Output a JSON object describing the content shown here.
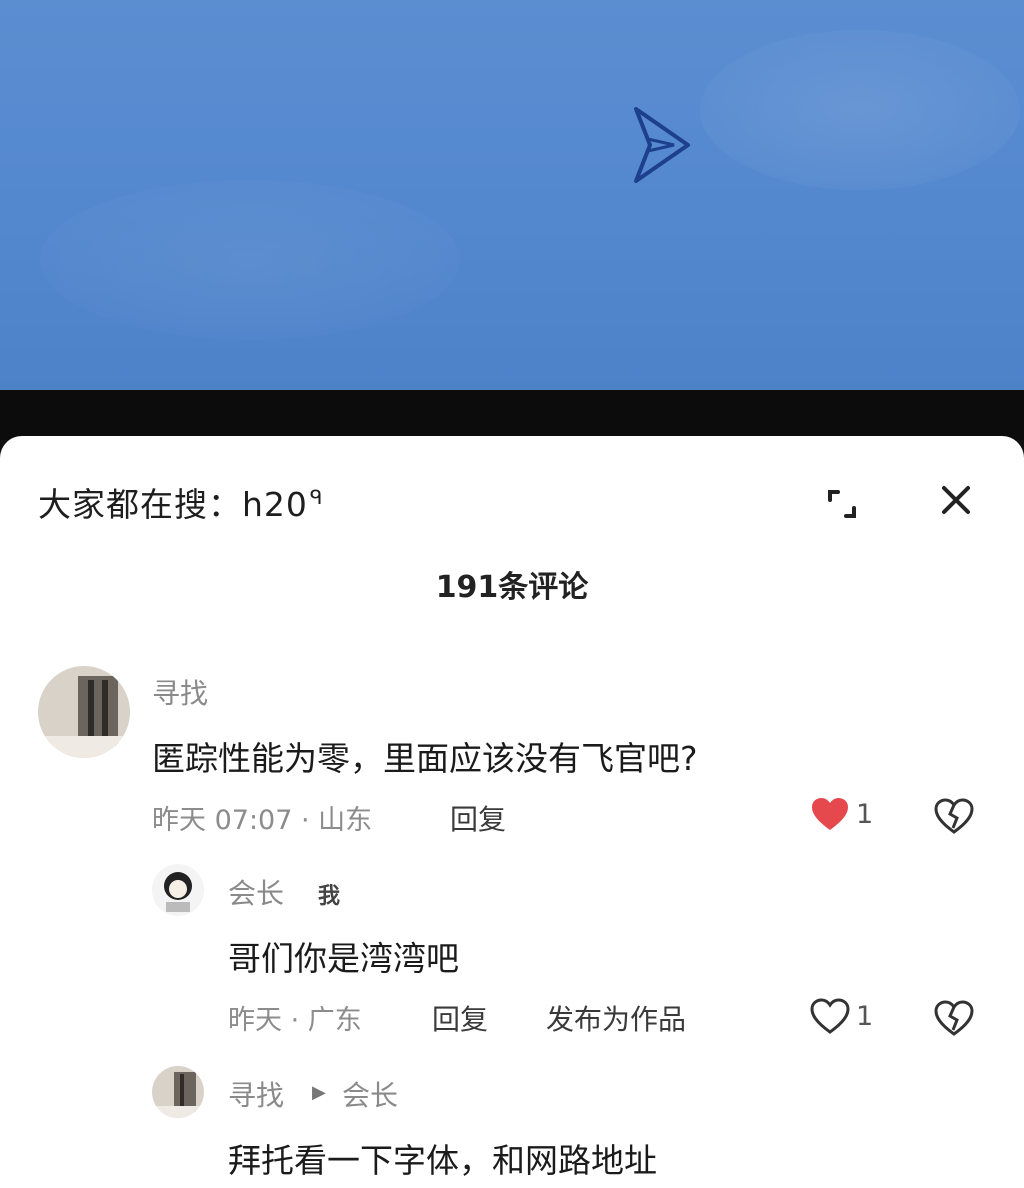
{
  "video": {
    "sky_color": "#5589cf",
    "aircraft_icon": "flying-wing-aircraft"
  },
  "sheet": {
    "search_hint": "大家都在搜：h20",
    "comment_count": "191条评论"
  },
  "comments": [
    {
      "username": "寻找",
      "text": "匿踪性能为零，里面应该没有飞官吧?",
      "meta": "昨天 07:07 · 山东",
      "reply": "回复",
      "likes": "1",
      "liked": true
    },
    {
      "username": "会长",
      "tag": "我",
      "text": "哥们你是湾湾吧",
      "meta": "昨天 · 广东",
      "reply": "回复",
      "publish": "发布为作品",
      "likes": "1",
      "liked": false
    },
    {
      "username": "寻找",
      "reply_to": "会长",
      "text": "拜托看一下字体，和网路地址"
    }
  ],
  "colors": {
    "like_red": "#e5484d",
    "muted": "#8a8a8a"
  }
}
